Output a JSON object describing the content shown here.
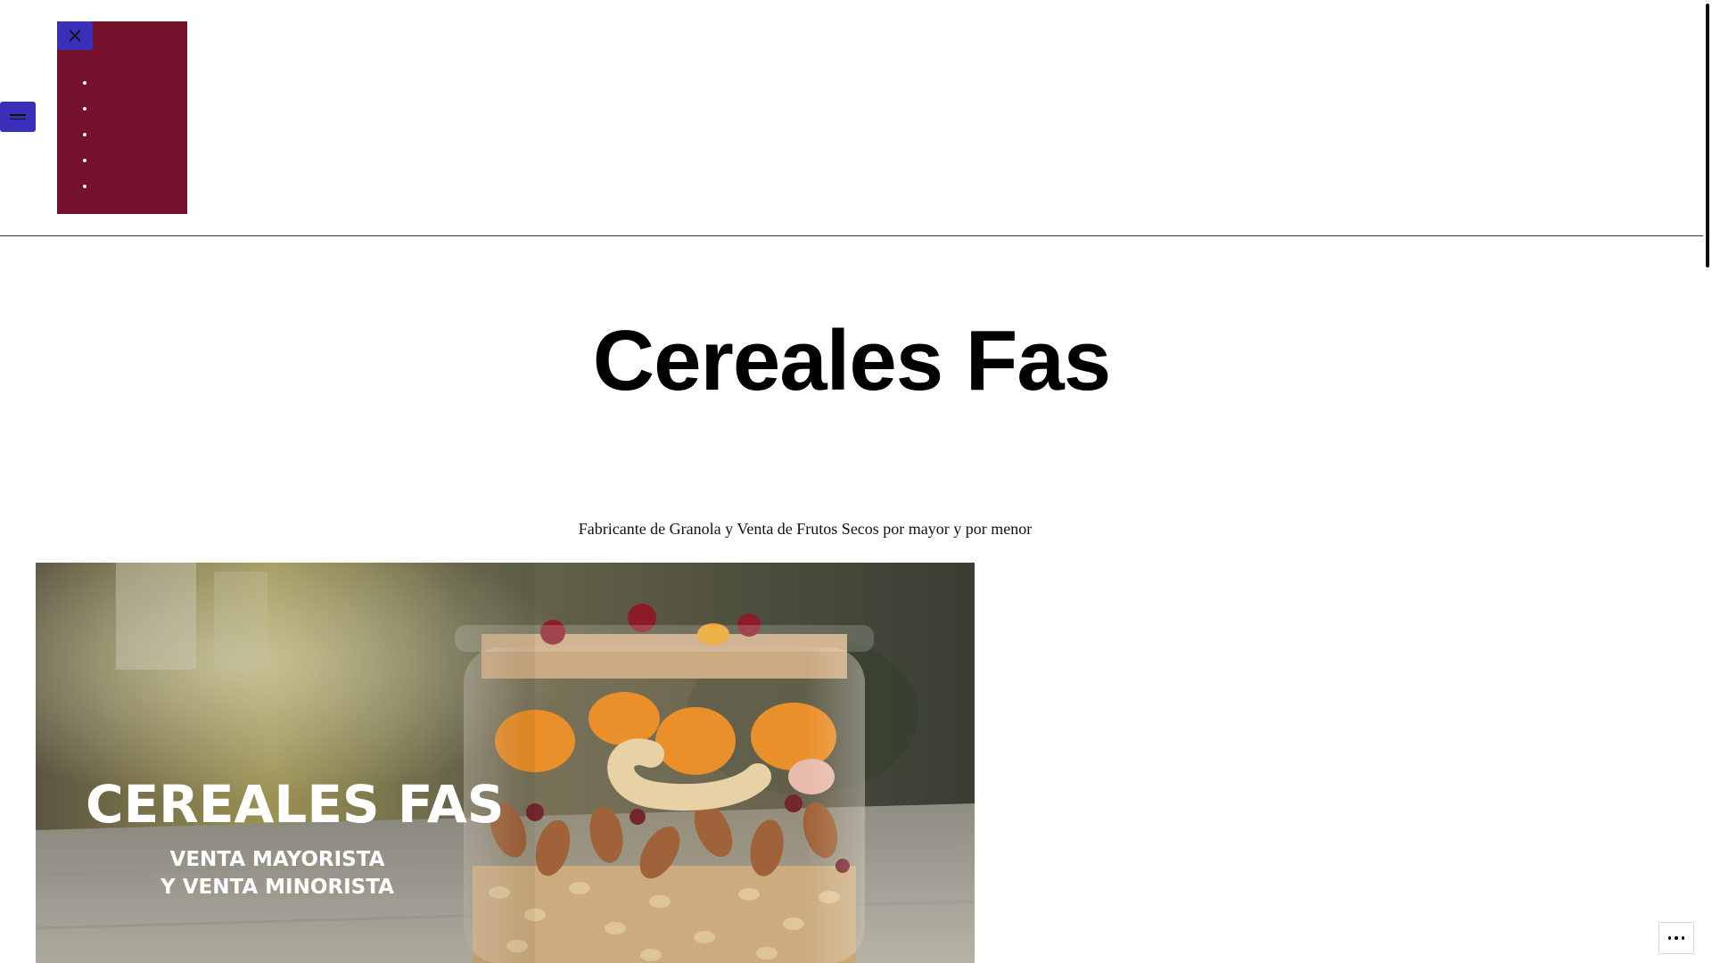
{
  "header": {
    "menu_items": [
      "",
      "",
      "",
      "",
      ""
    ],
    "colors": {
      "menu_panel": "#74112c",
      "buttons": "#3a2fb8"
    }
  },
  "icons": {
    "open_menu": "hamburger-icon",
    "close_menu": "close-icon",
    "more": "more-horizontal-icon"
  },
  "site": {
    "title": "Cereales Fas",
    "tagline": "Fabricante de Granola y Venta de Frutos Secos por mayor y por menor"
  },
  "hero": {
    "brand": "CEREALES FAS",
    "line1": "VENTA MAYORISTA",
    "line2": "Y VENTA MINORISTA"
  }
}
